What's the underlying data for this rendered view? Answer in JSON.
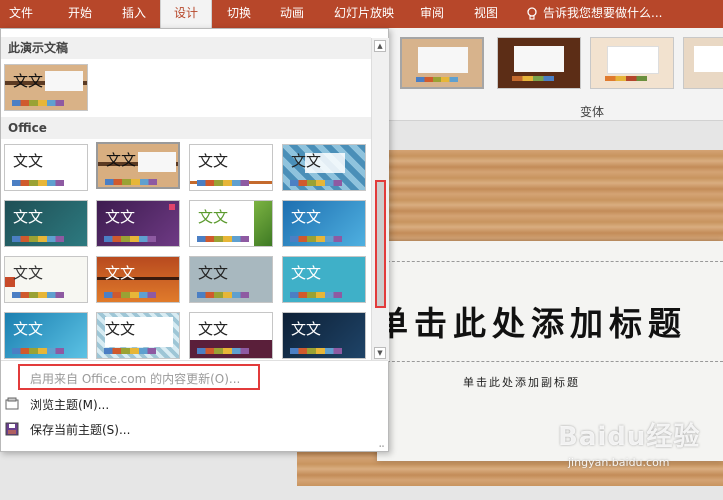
{
  "ribbon": {
    "tabs": [
      {
        "label": "文件",
        "active": false
      },
      {
        "label": "开始",
        "active": false
      },
      {
        "label": "插入",
        "active": false
      },
      {
        "label": "设计",
        "active": true
      },
      {
        "label": "切换",
        "active": false
      },
      {
        "label": "动画",
        "active": false
      },
      {
        "label": "幻灯片放映",
        "active": false
      },
      {
        "label": "审阅",
        "active": false
      },
      {
        "label": "视图",
        "active": false
      }
    ],
    "tell_me": "告诉我您想要做什么...",
    "variants_label": "变体",
    "accent": "#b7472a"
  },
  "gallery": {
    "this_presentation_header": "此演示文稿",
    "office_header": "Office",
    "current_theme_text": "文文",
    "theme_text": "文文",
    "menu": {
      "enable_updates": "启用来自 Office.com 的内容更新(O)...",
      "browse_themes": "浏览主题(M)...",
      "save_theme": "保存当前主题(S)..."
    }
  },
  "slide": {
    "title_placeholder": "单击此处添加标题",
    "subtitle_placeholder": "单击此处添加副标题"
  },
  "watermark": {
    "brand": "Baidu经验",
    "url": "jingyan.baidu.com"
  }
}
